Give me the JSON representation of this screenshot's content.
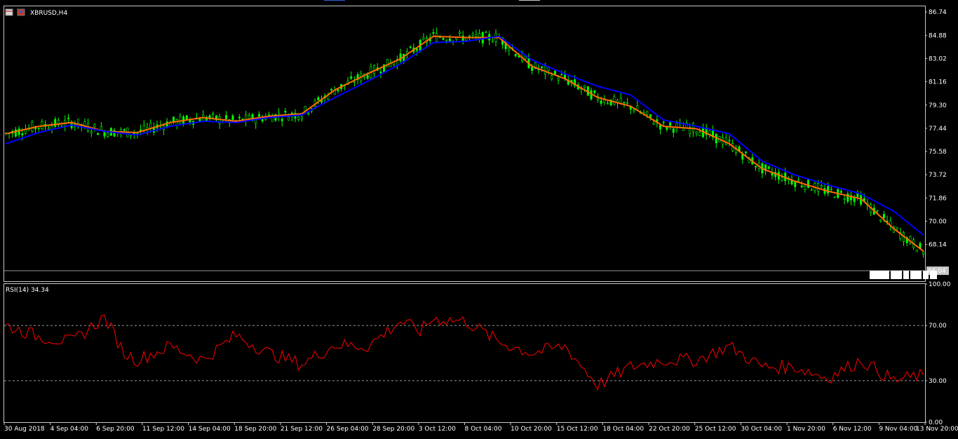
{
  "window": {
    "title": "XBRUSD,H4",
    "tab_colors": [
      "#2f5fd6",
      "#c8c8c8"
    ]
  },
  "chart_data": [
    {
      "type": "candlestick",
      "symbol": "XBRUSD",
      "timeframe": "H4",
      "ylim": [
        65.2,
        87.2
      ],
      "y_ticks": [
        "86.74",
        "84.88",
        "83.02",
        "81.16",
        "79.30",
        "77.44",
        "75.58",
        "73.72",
        "71.86",
        "70.00",
        "68.14"
      ],
      "y_tick_values": [
        86.74,
        84.88,
        83.02,
        81.16,
        79.3,
        77.44,
        75.58,
        73.72,
        71.86,
        70.0,
        68.14
      ],
      "current_price": "66.04",
      "candle_color": "#00ff00",
      "bid_line_color": "#c8c8c8",
      "time_markers": [
        "02:0",
        "21",
        "",
        "00",
        "",
        "0"
      ],
      "series": [
        {
          "name": "",
          "type": "line",
          "color": "#ff6a00",
          "x": [
            0,
            10,
            20,
            30,
            40,
            50,
            60,
            70,
            80,
            90,
            100,
            110,
            120,
            130,
            140,
            150,
            160,
            170,
            180,
            190,
            200,
            210,
            220,
            230,
            240,
            250,
            260,
            270,
            279
          ],
          "values": [
            77.0,
            77.6,
            77.9,
            77.2,
            77.1,
            77.9,
            78.3,
            78.0,
            78.4,
            78.6,
            80.5,
            81.8,
            83.0,
            84.8,
            84.7,
            84.7,
            82.4,
            81.4,
            79.9,
            79.2,
            77.6,
            77.4,
            76.2,
            74.2,
            73.2,
            72.4,
            71.8,
            69.4,
            67.6
          ]
        },
        {
          "name": "",
          "type": "line",
          "color": "#0000ff",
          "x": [
            0,
            10,
            20,
            30,
            40,
            50,
            60,
            70,
            80,
            90,
            100,
            110,
            120,
            130,
            140,
            150,
            160,
            170,
            180,
            190,
            200,
            210,
            220,
            230,
            240,
            250,
            260,
            270,
            279
          ],
          "values": [
            76.2,
            77.1,
            77.7,
            77.2,
            76.9,
            77.6,
            78.0,
            77.9,
            78.3,
            78.5,
            79.9,
            81.2,
            82.6,
            84.3,
            84.4,
            84.8,
            82.9,
            81.8,
            80.8,
            80.1,
            78.1,
            77.6,
            77.0,
            74.8,
            73.7,
            72.9,
            72.2,
            70.8,
            68.9
          ]
        }
      ]
    },
    {
      "type": "line",
      "title": "RSI(14) 34.34",
      "ylim": [
        0,
        100
      ],
      "y_ticks": [
        "100.00",
        "70.00",
        "30.00",
        "0.00"
      ],
      "y_tick_values": [
        100,
        70,
        30,
        0
      ],
      "levels": [
        70,
        30
      ],
      "series": [
        {
          "name": "",
          "color": "#ff0000",
          "x": [
            0,
            10,
            20,
            30,
            36,
            40,
            50,
            60,
            70,
            80,
            90,
            100,
            110,
            120,
            126,
            130,
            140,
            150,
            160,
            170,
            180,
            190,
            200,
            210,
            220,
            230,
            240,
            250,
            260,
            270,
            279
          ],
          "values": [
            70,
            62,
            58,
            76,
            50,
            45,
            55,
            45,
            63,
            50,
            42,
            56,
            55,
            73,
            66,
            75,
            73,
            58,
            50,
            55,
            27,
            40,
            45,
            45,
            55,
            40,
            40,
            32,
            45,
            30,
            34.34
          ]
        }
      ]
    }
  ],
  "x_axis": {
    "labels": [
      "30 Aug 2018",
      "4 Sep 04:00",
      "6 Sep 20:00",
      "11 Sep 12:00",
      "14 Sep 04:00",
      "18 Sep 20:00",
      "21 Sep 12:00",
      "26 Sep 04:00",
      "28 Sep 20:00",
      "3 Oct 12:00",
      "8 Oct 04:00",
      "10 Oct 20:00",
      "15 Oct 12:00",
      "18 Oct 04:00",
      "22 Oct 20:00",
      "25 Oct 12:00",
      "30 Oct 04:00",
      "1 Nov 20:00",
      "6 Nov 12:00",
      "9 Nov 04:00",
      "13 Nov 20:00"
    ],
    "label_x": [
      0,
      14,
      28,
      42,
      56,
      70,
      84,
      98,
      112,
      126,
      140,
      154,
      168,
      182,
      196,
      210,
      224,
      238,
      252,
      266,
      280
    ]
  }
}
